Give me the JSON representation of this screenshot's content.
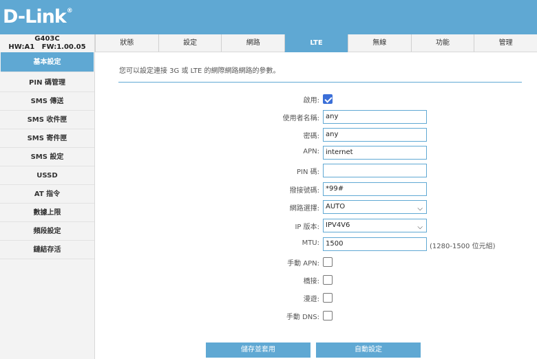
{
  "brand": {
    "logo_text": "D-Link",
    "logo_mark": "®"
  },
  "device": {
    "model": "G403C",
    "hw_fw": "HW:A1   FW:1.00.05"
  },
  "tabs": [
    {
      "label": "狀態"
    },
    {
      "label": "設定"
    },
    {
      "label": "網路"
    },
    {
      "label": "LTE",
      "active": true
    },
    {
      "label": "無線"
    },
    {
      "label": "功能"
    },
    {
      "label": "管理"
    }
  ],
  "sidebar": [
    {
      "label": "基本設定",
      "active": true
    },
    {
      "label": "PIN 碼管理"
    },
    {
      "label": "SMS 傳送"
    },
    {
      "label": "SMS 收件匣"
    },
    {
      "label": "SMS 寄件匣"
    },
    {
      "label": "SMS 設定"
    },
    {
      "label": "USSD"
    },
    {
      "label": "AT 指令"
    },
    {
      "label": "數據上限"
    },
    {
      "label": "頻段設定"
    },
    {
      "label": "鏈結存活"
    }
  ],
  "main": {
    "description": "您可以設定連接 3G 或 LTE 的網際網路網路的參數。",
    "form": {
      "enable_label": "啟用:",
      "enable_checked": true,
      "username_label": "使用者名稱:",
      "username_value": "any",
      "password_label": "密碼:",
      "password_value": "any",
      "apn_label": "APN:",
      "apn_value": "internet",
      "pin_label": "PIN 碼:",
      "pin_value": "",
      "dial_label": "撥接號碼:",
      "dial_value": "*99#",
      "network_label": "網路選擇:",
      "network_value": "AUTO",
      "ipver_label": "IP 版本:",
      "ipver_value": "IPV4V6",
      "mtu_label": "MTU:",
      "mtu_value": "1500",
      "mtu_hint": "(1280-1500 位元組)",
      "manual_apn_label": "手動 APN:",
      "manual_apn_checked": false,
      "bridge_label": "橋接:",
      "bridge_checked": false,
      "roaming_label": "漫遊:",
      "roaming_checked": false,
      "manual_dns_label": "手動 DNS:",
      "manual_dns_checked": false
    },
    "buttons": {
      "save_label": "儲存並套用",
      "auto_label": "自動設定"
    }
  },
  "colors": {
    "accent": "#5fa8d3",
    "checkbox_checked": "#3b6fd8"
  }
}
